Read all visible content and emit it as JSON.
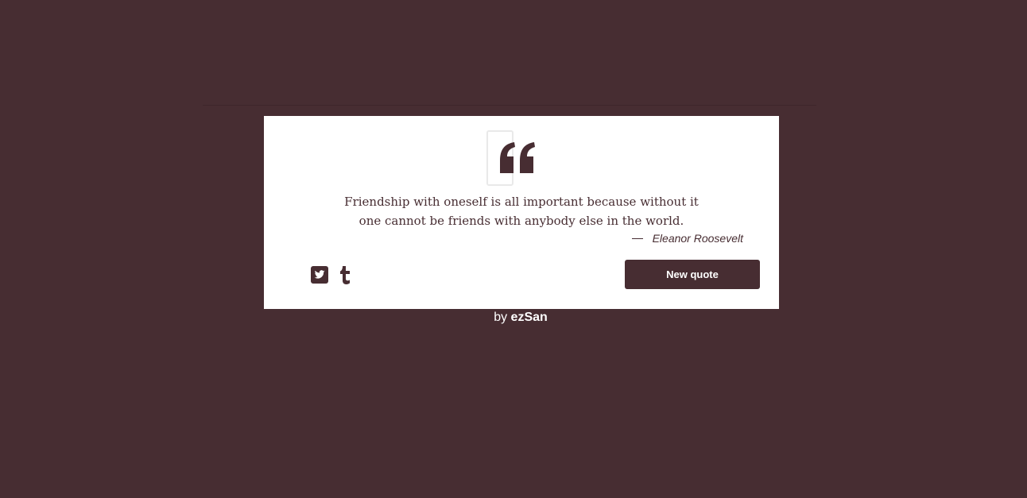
{
  "colors": {
    "background": "#472d32",
    "card": "#ffffff",
    "accent": "#472d32",
    "button_text": "#ffffff"
  },
  "quote": {
    "icon": "quote-left-icon",
    "text": "Friendship with oneself is all important because without it one cannot be friends with anybody else in the world.",
    "author": "Eleanor Roosevelt"
  },
  "social": {
    "twitter_icon": "twitter-icon",
    "tumblr_icon": "tumblr-icon"
  },
  "actions": {
    "new_quote_label": "New quote"
  },
  "footer": {
    "prefix": "by",
    "author": "ezSan"
  }
}
